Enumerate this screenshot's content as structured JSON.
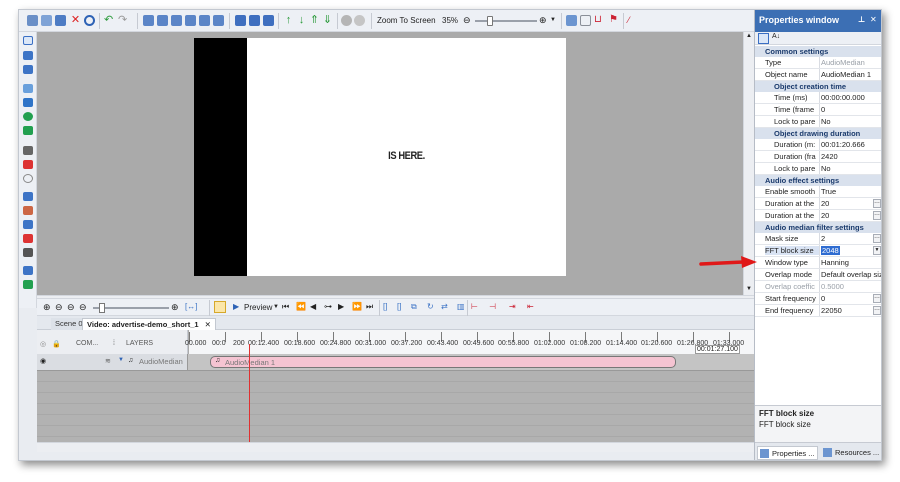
{
  "toolbar": {
    "zoom_label": "Zoom To Screen",
    "zoom_value": "35%"
  },
  "canvas": {
    "video_text": "IS HERE."
  },
  "timeline_toolbar": {
    "preview_label": "Preview"
  },
  "tabs": [
    {
      "label": "Scene 0"
    },
    {
      "label": "Video: advertise-demo_short_1"
    }
  ],
  "timeline": {
    "header_com": "COM...",
    "header_layers": "LAYERS",
    "ruler_labels": [
      "00.000",
      "00:0",
      "200",
      "00:12.400",
      "00:18.600",
      "00:24.800",
      "00:31.000",
      "00:37.200",
      "00:43.400",
      "00:49.600",
      "00:55.800",
      "01:02.000",
      "01:08.200",
      "01:14.400",
      "01:20.600",
      "01:26.800",
      "01:33.000"
    ],
    "end_time": "00:01:27.100",
    "track_label": "AudioMedian",
    "clip_label": "AudioMedian 1"
  },
  "properties": {
    "title": "Properties window",
    "pin": "⊥",
    "close": "✕",
    "sections": [
      {
        "label": "Common settings"
      },
      {
        "label": "Object creation time"
      },
      {
        "label": "Object drawing duration"
      },
      {
        "label": "Audio effect settings"
      },
      {
        "label": "Audio median filter settings"
      }
    ],
    "rows": [
      {
        "name": "Type",
        "value": "AudioMedian"
      },
      {
        "name": "Object name",
        "value": "AudioMedian 1"
      },
      {
        "name": "Time (ms)",
        "value": "00:00:00.000"
      },
      {
        "name": "Time (frame",
        "value": "0"
      },
      {
        "name": "Lock to pare",
        "value": "No"
      },
      {
        "name": "Duration (m:",
        "value": "00:01:20.666"
      },
      {
        "name": "Duration (fra",
        "value": "2420"
      },
      {
        "name": "Lock to pare",
        "value": "No"
      },
      {
        "name": "Enable smooth",
        "value": "True"
      },
      {
        "name": "Duration at the",
        "value": "20"
      },
      {
        "name": "Duration at the",
        "value": "20"
      },
      {
        "name": "Mask size",
        "value": "2"
      },
      {
        "name": "FFT block size",
        "value": "2048"
      },
      {
        "name": "Window type",
        "value": "Hanning"
      },
      {
        "name": "Overlap mode",
        "value": "Default overlap siz"
      },
      {
        "name": "Overlap coeffic",
        "value": "0.5000"
      },
      {
        "name": "Start frequency",
        "value": "0"
      },
      {
        "name": "End frequency",
        "value": "22050"
      }
    ],
    "description_title": "FFT block size",
    "description_text": "FFT block size",
    "tabs": [
      {
        "label": "Properties ..."
      },
      {
        "label": "Resources ..."
      }
    ]
  },
  "colors": {
    "title_bar": "#3c6fb4",
    "annotation_arrow": "#e01818",
    "clip": "#f5c4d2",
    "playhead": "#e03030"
  }
}
